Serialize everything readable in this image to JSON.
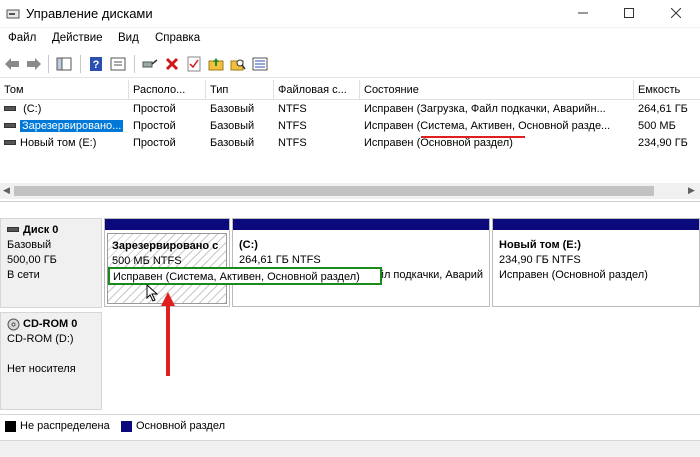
{
  "window": {
    "title": "Управление дисками"
  },
  "menu": [
    "Файл",
    "Действие",
    "Вид",
    "Справка"
  ],
  "volume_table": {
    "headers": [
      "Том",
      "Располо...",
      "Тип",
      "Файловая с...",
      "Состояние",
      "Емкость"
    ],
    "rows": [
      {
        "volume": "(C:)",
        "layout": "Простой",
        "type": "Базовый",
        "fs": "NTFS",
        "status": "Исправен (Загрузка, Файл подкачки, Аварийн...",
        "capacity": "264,61 ГБ"
      },
      {
        "volume": "Зарезервировано...",
        "layout": "Простой",
        "type": "Базовый",
        "fs": "NTFS",
        "status": "Исправен (Система, Активен, Основной разде...",
        "capacity": "500 МБ"
      },
      {
        "volume": "Новый том (E:)",
        "layout": "Простой",
        "type": "Базовый",
        "fs": "NTFS",
        "status": "Исправен (Основной раздел)",
        "capacity": "234,90 ГБ"
      }
    ]
  },
  "disks": [
    {
      "title": "Диск 0",
      "line1": "Базовый",
      "line2": "500,00 ГБ",
      "line3": "В сети"
    },
    {
      "title": "CD-ROM 0",
      "line1": "CD-ROM (D:)",
      "line2": "",
      "line3": "Нет носителя"
    }
  ],
  "partitions": [
    {
      "name": "Зарезервировано с",
      "size": "500 МБ NTFS",
      "status": "Исправен (Система, Активен, Основной раздел)"
    },
    {
      "name": "(C:)",
      "size": "264,61 ГБ NTFS",
      "status": "Исправен (Загрузка, Файл подкачки, Аварий"
    },
    {
      "name": "Новый том  (E:)",
      "size": "234,90 ГБ NTFS",
      "status": "Исправен (Основной раздел)"
    }
  ],
  "legend": [
    {
      "label": "Не распределена",
      "color": "#000000"
    },
    {
      "label": "Основной раздел",
      "color": "#0a0a7c"
    }
  ],
  "colors": {
    "selection": "#0078d7",
    "highlight_box": "#1a8a1a",
    "annotation": "#e0201e",
    "partition_bar": "#0a0a7c"
  }
}
